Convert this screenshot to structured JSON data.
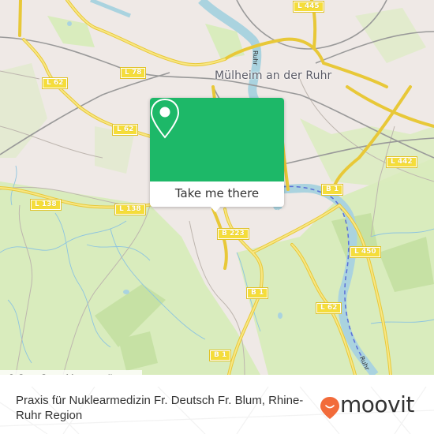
{
  "map": {
    "city_label": "Mülheim an der Ruhr",
    "river_labels": [
      "Ruhr",
      "Ruhr"
    ],
    "road_shields": [
      "L 445",
      "L 78",
      "L 62",
      "L 62",
      "L 442",
      "B 1",
      "L 138",
      "L 138",
      "B 223",
      "L 450",
      "B 1",
      "L 62",
      "B 1"
    ],
    "colors": {
      "land": "#efe9e6",
      "green": "#d9ecbd",
      "water": "#aad3df",
      "road": "#f5dd3a"
    }
  },
  "popup": {
    "icon": "map-pin-icon",
    "button_label": "Take me there",
    "color": "#1db868"
  },
  "attribution": "© OpenStreetMap contributors",
  "footer": {
    "place_name": "Praxis für Nuklearmedizin Fr. Deutsch Fr. Blum, Rhine-Ruhr Region",
    "brand": "moovit",
    "brand_color": "#f26b3a"
  }
}
